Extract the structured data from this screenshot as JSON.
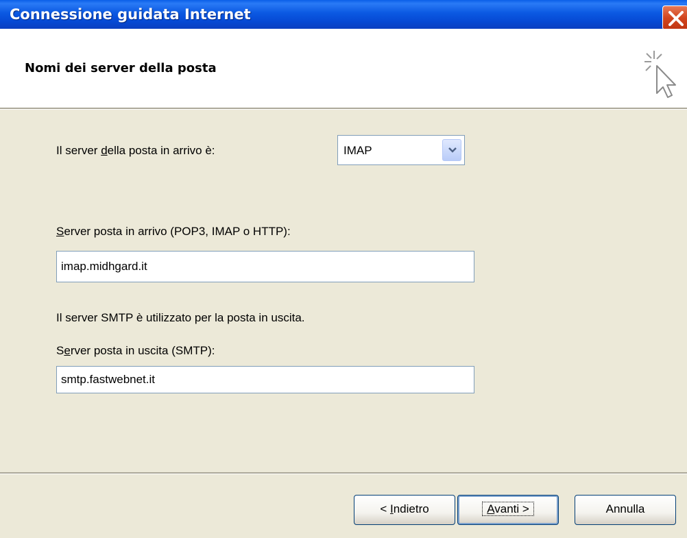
{
  "window": {
    "title": "Connessione guidata Internet"
  },
  "header": {
    "title": "Nomi dei server della posta",
    "icon": "wizard-cursor-icon"
  },
  "form": {
    "incoming_type_label_pre": "Il server ",
    "incoming_type_label_u": "d",
    "incoming_type_label_post": "ella posta in arrivo è:",
    "incoming_type_value": "IMAP",
    "incoming_server_label_u": "S",
    "incoming_server_label_post": "erver posta in arrivo (POP3, IMAP o HTTP):",
    "incoming_server_value": "imap.midhgard.it",
    "smtp_info": "Il server SMTP è utilizzato per la posta in uscita.",
    "outgoing_server_label_pre": "S",
    "outgoing_server_label_u": "e",
    "outgoing_server_label_post": "rver posta in uscita (SMTP):",
    "outgoing_server_value": "smtp.fastwebnet.it"
  },
  "buttons": {
    "back_pre": "< ",
    "back_u": "I",
    "back_post": "ndietro",
    "next_u": "A",
    "next_post": "vanti >",
    "cancel": "Annulla"
  },
  "colors": {
    "titlebar": "#0A5FE8",
    "dialog_bg": "#ECE9D8",
    "close": "#D2451E"
  }
}
